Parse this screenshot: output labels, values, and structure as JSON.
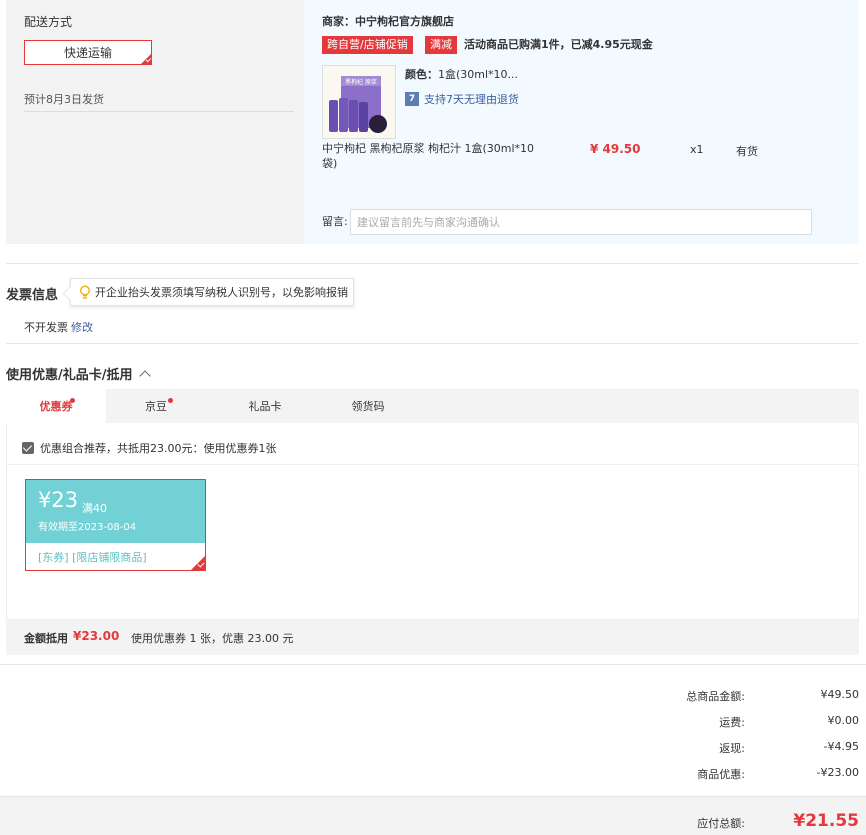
{
  "shipping": {
    "title": "配送方式",
    "method_label": "快递运输",
    "estimate": "预计8月3日发货"
  },
  "store": {
    "seller": "商家：中宁枸杞官方旗舰店",
    "tags": [
      "跨自营/店铺促销",
      "满减"
    ],
    "promo_text": "活动商品已购满1件，已减4.95元现金",
    "product": {
      "color_label": "颜色：",
      "color_value": "1盒(30ml*10...",
      "return_icon": "7",
      "return_text": "支持7天无理由退货",
      "name": "中宁枸杞 黑枸杞原浆 枸杞汁 1盒(30ml*10袋)",
      "image_text": "黑枸杞 原浆",
      "price": "¥ 49.50",
      "qty": "x1",
      "stock": "有货"
    },
    "message_label": "留言:",
    "message_placeholder": "建议留言前先与商家沟通确认"
  },
  "invoice": {
    "title": "发票信息",
    "tip": "开企业抬头发票须填写纳税人识别号，以免影响报销",
    "status": "不开发票",
    "edit": "修改"
  },
  "coupons": {
    "title": "使用优惠/礼品卡/抵用",
    "tabs": [
      {
        "label": "优惠券",
        "dot": true
      },
      {
        "label": "京豆",
        "dot": true
      },
      {
        "label": "礼品卡",
        "dot": false
      },
      {
        "label": "领货码",
        "dot": false
      }
    ],
    "recommend": "优惠组合推荐，共抵用23.00元：使用优惠券1张",
    "card": {
      "amount": "¥23",
      "condition": "满40",
      "expiry": "有效期至2023-08-04",
      "scope": "[东券] [限店铺限商品]"
    },
    "summary_label": "金额抵用",
    "summary_amount": "¥23.00",
    "summary_desc": "使用优惠券 1 张，优惠 23.00 元"
  },
  "totals": {
    "rows": [
      {
        "label": "总商品金额:",
        "value": "¥49.50"
      },
      {
        "label": "运费:",
        "value": "¥0.00"
      },
      {
        "label": "返现:",
        "value": "-¥4.95"
      },
      {
        "label": "商品优惠:",
        "value": "-¥23.00"
      }
    ],
    "final_label": "应付总额:",
    "final_value": "¥21.55"
  },
  "colors": {
    "accent": "#e4393c",
    "coupon_bg": "#72d1d5",
    "link": "#3a5fa0"
  }
}
